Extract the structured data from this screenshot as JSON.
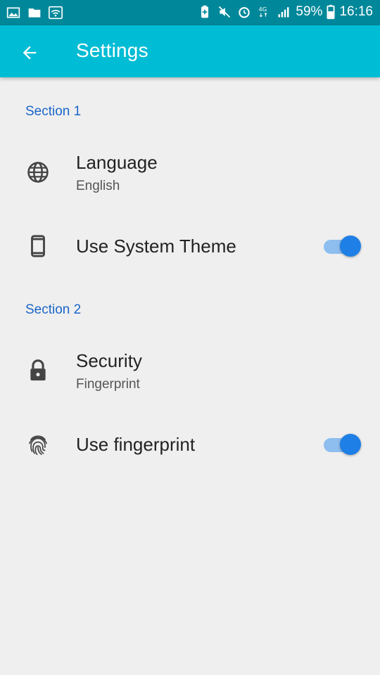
{
  "status_bar": {
    "left_icons": [
      "image-icon",
      "folder-icon",
      "wifi-icon"
    ],
    "right_icons": [
      "battery-saver-icon",
      "mute-icon",
      "alarm-icon",
      "network-4g-icon",
      "signal-icon"
    ],
    "battery_percent": "59%",
    "time": "16:16"
  },
  "app_bar": {
    "back_icon": "arrow-back-icon",
    "title": "Settings"
  },
  "sections": [
    {
      "header": "Section 1",
      "items": [
        {
          "icon": "globe-icon",
          "title": "Language",
          "subtitle": "English"
        },
        {
          "icon": "phone-icon",
          "title": "Use System Theme",
          "toggle": true
        }
      ]
    },
    {
      "header": "Section 2",
      "items": [
        {
          "icon": "lock-icon",
          "title": "Security",
          "subtitle": "Fingerprint"
        },
        {
          "icon": "fingerprint-icon",
          "title": "Use fingerprint",
          "toggle": true
        }
      ]
    }
  ],
  "colors": {
    "status_bar": "#00889a",
    "app_bar": "#00bcd4",
    "section_header": "#1a66c8",
    "toggle_thumb": "#1e7fe6",
    "toggle_track": "#8ebef0",
    "background": "#efefef"
  }
}
